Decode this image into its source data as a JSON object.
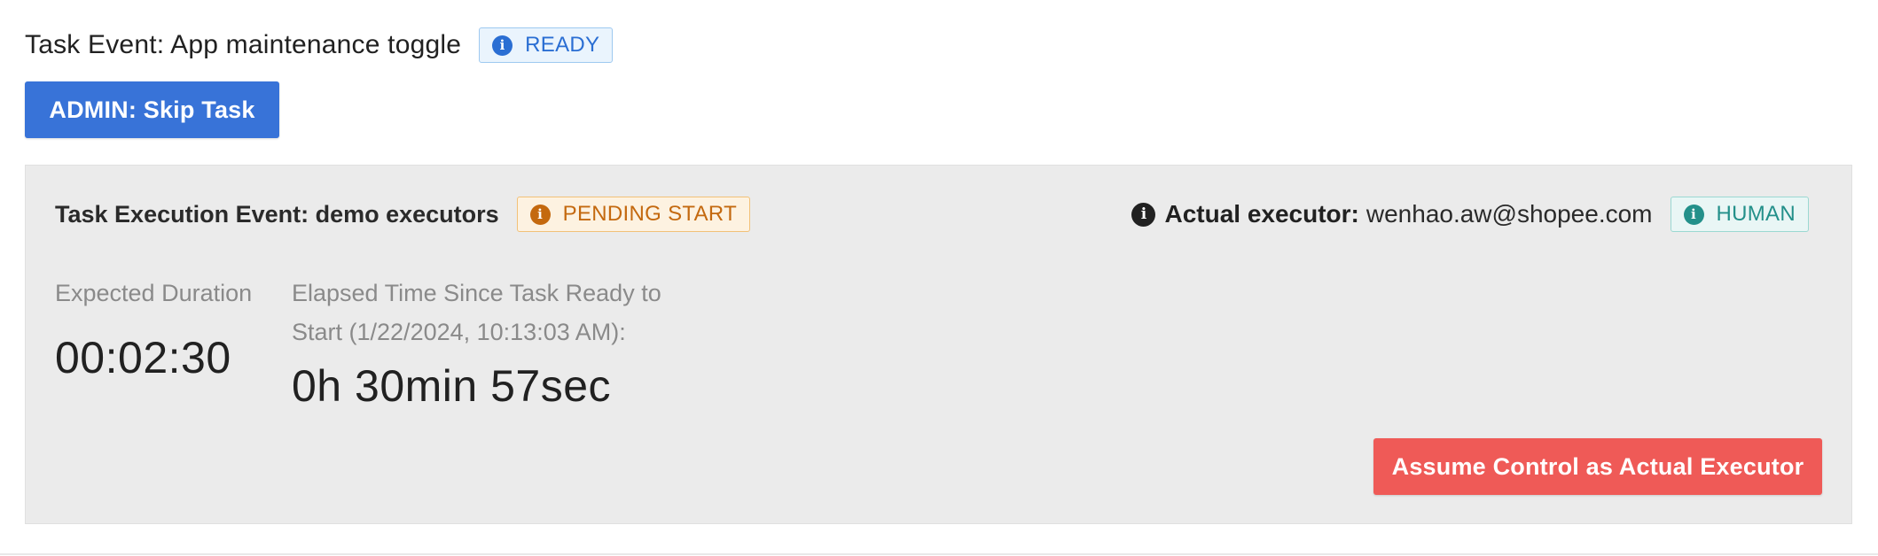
{
  "task": {
    "title": "Task Event: App maintenance toggle",
    "status_badge": {
      "icon": "info-icon",
      "label": "READY",
      "color": "#2a6ed3"
    },
    "skip_button_label": "ADMIN: Skip Task"
  },
  "execution": {
    "title": "Task Execution Event: demo executors",
    "status_badge": {
      "icon": "info-icon",
      "label": "PENDING START",
      "color": "#c4690f"
    },
    "actual_executor_label": "Actual executor:",
    "actual_executor_value": "wenhao.aw@shopee.com",
    "executor_type_badge": {
      "icon": "info-icon",
      "label": "HUMAN",
      "color": "#23908a"
    },
    "expected_duration_label": "Expected Duration",
    "expected_duration_value": "00:02:30",
    "elapsed_label": "Elapsed Time Since Task Ready to Start (1/22/2024, 10:13:03 AM):",
    "elapsed_value": "0h 30min 57sec",
    "assume_button_label": "Assume Control as Actual Executor"
  },
  "colors": {
    "primary_button": "#3873d8",
    "danger_button": "#ef5a57",
    "panel_background": "#ebebeb"
  }
}
